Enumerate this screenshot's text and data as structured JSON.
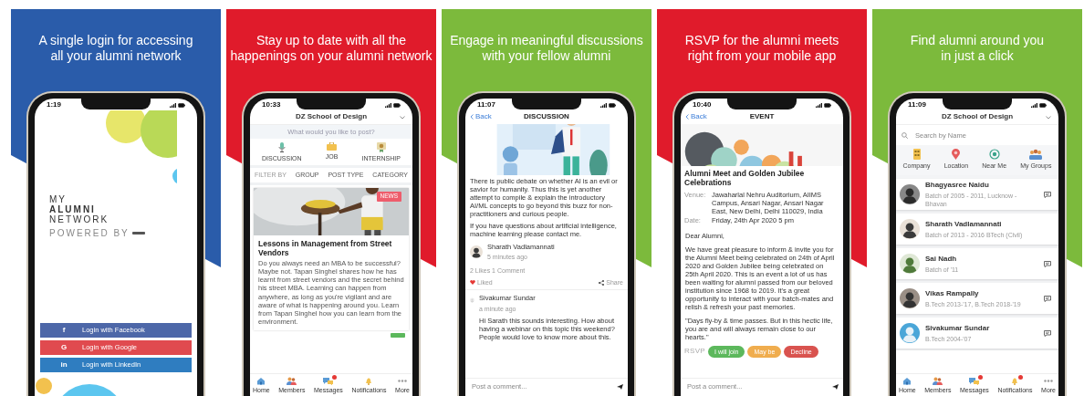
{
  "panels": [
    {
      "color": "#2a5caa",
      "headline_lines": [
        "A single login for accessing",
        "all your alumni network"
      ],
      "screen": {
        "kind": "login",
        "time": "1:19",
        "logo_lines": [
          "MY",
          "ALUMNI",
          "NETWORK"
        ],
        "powered_by": "POWERED BY",
        "buttons": [
          {
            "icon": "f",
            "label": "Login with Facebook",
            "color": "#4d67a8"
          },
          {
            "icon": "G",
            "label": "Login with Google",
            "color": "#e04a4f"
          },
          {
            "icon": "in",
            "label": "Login with LinkedIn",
            "color": "#2f7dc0"
          }
        ]
      }
    },
    {
      "color": "#e01b2b",
      "headline_lines": [
        "Stay up to date with all the",
        "happenings on your alumni network"
      ],
      "screen": {
        "kind": "feed",
        "time": "10:33",
        "school": "DZ School of Design",
        "post_placeholder": "What would you like to post?",
        "post_types": [
          "DISCUSSION",
          "JOB",
          "INTERNSHIP"
        ],
        "filter_label": "FILTER BY",
        "filters": [
          "GROUP",
          "POST TYPE",
          "CATEGORY"
        ],
        "post": {
          "tag": "NEWS",
          "title": "Lessons in Management from Street Vendors",
          "body": "Do you always need an MBA to be successful? Maybe not. Tapan Singhel shares how he has learnt from street vendors and the secret behind his street MBA. Learning can happen from anywhere, as long as you're vigilant and are aware of what is happening around you. Learn from Tapan Singhel how you can learn from the environment."
        },
        "nav": [
          {
            "label": "Home",
            "alert": false
          },
          {
            "label": "Members",
            "alert": false
          },
          {
            "label": "Messages",
            "alert": true
          },
          {
            "label": "Notifications",
            "alert": false
          },
          {
            "label": "More",
            "alert": false
          }
        ]
      }
    },
    {
      "color": "#7cba3c",
      "headline_lines": [
        "Engage in meaningful discussions",
        "with your fellow alumni"
      ],
      "screen": {
        "kind": "discussion",
        "time": "11:07",
        "back": "Back",
        "title": "DISCUSSION",
        "paragraphs": [
          "There is public debate on whether AI is an evil or savior for humanity. Thus this is yet another attempt to compile & explain the introductory AI/ML concepts to go beyond this buzz for non-practitioners and curious people.",
          "If you have questions about artificial intelligence, machine learning please contact me."
        ],
        "author": {
          "name": "Sharath Vadlamannati",
          "time": "5 minutes ago"
        },
        "stats": "2 Likes  1 Comment",
        "like": {
          "label": "Liked",
          "liked": true
        },
        "share": "Share",
        "comment": {
          "name": "Sivakumar Sundar",
          "time": "a minute ago",
          "text": "Hi Sarath this sounds interesting. How about having a webinar on this topic this weekend? People would love to know more about this."
        },
        "comment_placeholder": "Post a comment..."
      }
    },
    {
      "color": "#e01b2b",
      "headline_lines": [
        "RSVP for the alumni meets",
        "right from your mobile app"
      ],
      "screen": {
        "kind": "event",
        "time": "10:40",
        "back": "Back",
        "title": "EVENT",
        "event_title": "Alumni Meet and Golden Jubilee Celebrations",
        "details": [
          {
            "label": "Venue:",
            "value": "Jawaharlal Nehru Auditorium, AIIMS Campus, Ansari Nagar, Ansari Nagar East, New Delhi, Delhi 110029, India"
          },
          {
            "label": "Date:",
            "value": "Friday, 24th Apr 2020 5 pm"
          }
        ],
        "greeting": "Dear Alumni,",
        "paragraphs": [
          "We have great pleasure to inform & invite you for the Alumni Meet being celebrated on 24th of April 2020 and Golden Jubilee being celebrated on 25th April 2020. This is an event a lot of us has been waiting for alumni passed from our beloved institution since 1968 to 2019. It's a great opportunity to interact with your batch-mates and relish & refresh your past memories.",
          "\"Days fly-by & time passes. But in this hectic life, you are and will always remain close to our hearts.\""
        ],
        "rsvp_label": "RSVP",
        "rsvp_options": [
          {
            "label": "I will join",
            "color": "#5cb85c"
          },
          {
            "label": "May be",
            "color": "#f0ad4e"
          },
          {
            "label": "Decline",
            "color": "#d9534f"
          }
        ],
        "comment_placeholder": "Post a comment..."
      }
    },
    {
      "color": "#7cba3c",
      "headline_lines": [
        "Find alumni around you",
        "in just a click"
      ],
      "screen": {
        "kind": "directory",
        "time": "11:09",
        "school": "DZ School of Design",
        "search_placeholder": "Search by Name",
        "filters": [
          "Company",
          "Location",
          "Near Me",
          "My Groups"
        ],
        "members": [
          {
            "name": "Bhagyasree Naidu",
            "detail": "Batch of 2005 - 2011, Lucknow - Bhavan",
            "message_button": true
          },
          {
            "name": "Sharath Vadlamannati",
            "detail": "Batch of 2013 - 2016 BTech (Civil)",
            "message_button": false
          },
          {
            "name": "Sai Nadh",
            "detail": "Batch of '11",
            "message_button": true
          },
          {
            "name": "Vikas Rampally",
            "detail": "B.Tech 2013-'17, B.Tech 2018-'19",
            "message_button": true
          },
          {
            "name": "Sivakumar Sundar",
            "detail": "B.Tech 2004-'07",
            "message_button": true
          }
        ],
        "nav": [
          {
            "label": "Home",
            "alert": false
          },
          {
            "label": "Members",
            "alert": false
          },
          {
            "label": "Messages",
            "alert": true
          },
          {
            "label": "Notifications",
            "alert": true
          },
          {
            "label": "More",
            "alert": false
          }
        ]
      }
    }
  ]
}
